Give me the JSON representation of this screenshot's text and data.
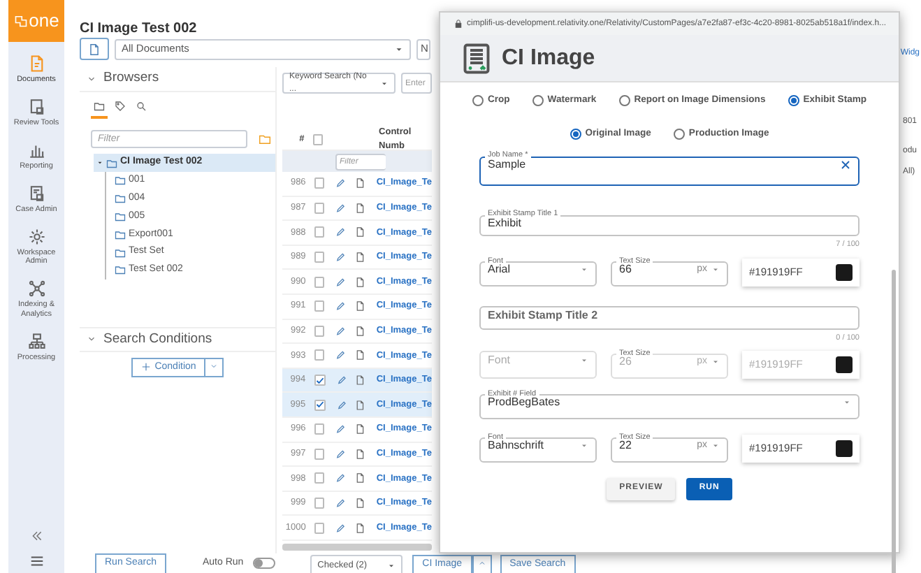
{
  "sidebar": {
    "logo": "one",
    "items": [
      {
        "label": "Documents",
        "selected": true
      },
      {
        "label": "Review Tools",
        "selected": false
      },
      {
        "label": "Reporting",
        "selected": false
      },
      {
        "label": "Case Admin",
        "selected": false
      },
      {
        "label": "Workspace Admin",
        "selected": false
      },
      {
        "label": "Indexing & Analytics",
        "selected": false
      },
      {
        "label": "Processing",
        "selected": false
      }
    ]
  },
  "header": {
    "title": "CI Image Test 002",
    "view_select": "All Documents",
    "cut_select": "N",
    "right_fragment": "Widg"
  },
  "browsers": {
    "title": "Browsers",
    "tabs": [
      {
        "selected": true
      },
      {
        "selected": false
      },
      {
        "selected": false
      }
    ],
    "filter_placeholder": "Filter",
    "tree": [
      {
        "label": "CI Image Test 002",
        "expanded": true,
        "selected": true,
        "children": [
          {
            "label": "001",
            "selected": false
          },
          {
            "label": "004",
            "selected": false
          },
          {
            "label": "005",
            "selected": false
          },
          {
            "label": "Export001",
            "selected": false
          },
          {
            "label": "Test Set",
            "selected": false
          },
          {
            "label": "Test Set 002",
            "selected": false
          }
        ]
      }
    ]
  },
  "search_conditions": {
    "title": "Search Conditions",
    "button": "Condition"
  },
  "footer": {
    "run_search": "Run Search",
    "auto_run": {
      "label": "Auto Run",
      "on": false
    }
  },
  "grid": {
    "keyword_select": "Keyword Search (No ...",
    "enter_placeholder": "Enter",
    "columns": [
      "#",
      "Control Numb"
    ],
    "all_checked": false,
    "filter_placeholder": "Filter",
    "rows": [
      {
        "number": "986",
        "checked": false,
        "control": "CI_Image_Te"
      },
      {
        "number": "987",
        "checked": false,
        "control": "CI_Image_Te"
      },
      {
        "number": "988",
        "checked": false,
        "control": "CI_Image_Te"
      },
      {
        "number": "989",
        "checked": false,
        "control": "CI_Image_Te"
      },
      {
        "number": "990",
        "checked": false,
        "control": "CI_Image_Te"
      },
      {
        "number": "991",
        "checked": false,
        "control": "CI_Image_Te"
      },
      {
        "number": "992",
        "checked": false,
        "control": "CI_Image_Te"
      },
      {
        "number": "993",
        "checked": false,
        "control": "CI_Image_Te"
      },
      {
        "number": "994",
        "checked": true,
        "control": "CI_Image_Te"
      },
      {
        "number": "995",
        "checked": true,
        "control": "CI_Image_Te"
      },
      {
        "number": "996",
        "checked": false,
        "control": "CI_Image_Te"
      },
      {
        "number": "997",
        "checked": false,
        "control": "CI_Image_Te"
      },
      {
        "number": "998",
        "checked": false,
        "control": "CI_Image_Te"
      },
      {
        "number": "999",
        "checked": false,
        "control": "CI_Image_Te"
      },
      {
        "number": "1000",
        "checked": false,
        "control": "CI_Image_Te"
      }
    ],
    "right_fragments": [
      "801",
      "odu",
      "All)"
    ],
    "checked_select": "Checked (2)",
    "ci_image_button": "CI Image",
    "save_search": "Save Search"
  },
  "dialog": {
    "url": "cimplifi-us-development.relativity.one/Relativity/CustomPages/a7e2fa87-ef3c-4c20-8981-8025ab518a1f/index.h...",
    "title": "CI Image",
    "operations": [
      {
        "label": "Crop",
        "selected": false
      },
      {
        "label": "Watermark",
        "selected": false
      },
      {
        "label": "Report on Image Dimensions",
        "selected": false
      },
      {
        "label": "Exhibit Stamp",
        "selected": true
      }
    ],
    "sources": [
      {
        "label": "Original Image",
        "selected": true
      },
      {
        "label": "Production Image",
        "selected": false
      }
    ],
    "job_name": {
      "label": "Job Name *",
      "value": "Sample"
    },
    "title_1": {
      "label": "Exhibit Stamp Title 1",
      "value": "Exhibit",
      "counter": "7 / 100"
    },
    "title_2": {
      "placeholder": "Exhibit Stamp Title 2",
      "counter": "0 / 100"
    },
    "exhibit_field": {
      "label": "Exhibit # Field",
      "value": "ProdBegBates"
    },
    "font_rows": [
      {
        "font_label": "Font",
        "font": "Arial",
        "size_label": "Text Size",
        "size": "66",
        "unit": "px",
        "color_text": "#191919FF",
        "color": "#191919",
        "disabled": false
      },
      {
        "font_placeholder": "Font",
        "size_label": "Text Size",
        "size": "26",
        "unit": "px",
        "color_text": "#191919FF",
        "color": "#191919",
        "disabled": true
      },
      {
        "font_label": "Font",
        "font": "Bahnschrift",
        "size_label": "Text Size",
        "size": "22",
        "unit": "px",
        "color_text": "#191919FF",
        "color": "#191919",
        "disabled": false
      }
    ],
    "buttons": [
      {
        "label": "PREVIEW",
        "kind": "secondary"
      },
      {
        "label": "RUN",
        "kind": "primary"
      }
    ]
  }
}
